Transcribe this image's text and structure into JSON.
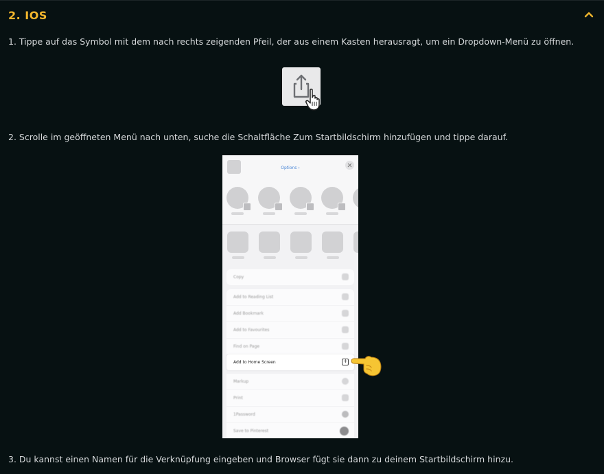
{
  "section": {
    "title": "2.  IOS",
    "expanded": true
  },
  "steps": [
    "1. Tippe auf das Symbol mit dem nach rechts zeigenden Pfeil, der aus einem Kasten herausragt, um ein Dropdown-Menü zu öffnen.",
    "2. Scrolle im geöffneten Menü nach unten, suche die Schaltfläche Zum Startbildschirm hinzufügen und tippe darauf.",
    "3. Du kannst einen Namen für die Verknüpfung eingeben und Browser fügt sie dann zu deinem Startbildschirm hinzu."
  ],
  "share_image": {
    "icon": "share-icon",
    "cursor": "hand-pointer-icon"
  },
  "phone": {
    "options_label": "Options ›",
    "menu": [
      {
        "label": "Copy",
        "icon": "copy-icon"
      },
      {
        "label": "Add to Reading List",
        "icon": "glasses-icon"
      },
      {
        "label": "Add Bookmark",
        "icon": "book-icon"
      },
      {
        "label": "Add to Favourites",
        "icon": "star-icon"
      },
      {
        "label": "Find on Page",
        "icon": "search-icon"
      },
      {
        "label": "Add to Home Screen",
        "icon": "add-square-icon",
        "highlighted": true
      },
      {
        "label": "Markup",
        "icon": "markup-icon"
      },
      {
        "label": "Print",
        "icon": "print-icon"
      },
      {
        "label": "1Password",
        "icon": "password-icon"
      },
      {
        "label": "Save to Pinterest",
        "icon": "pinterest-icon"
      }
    ],
    "pointer": "pointing-hand-emoji-icon"
  },
  "colors": {
    "accent": "#f2b62d",
    "background": "#071112",
    "text": "#d5d8da"
  }
}
